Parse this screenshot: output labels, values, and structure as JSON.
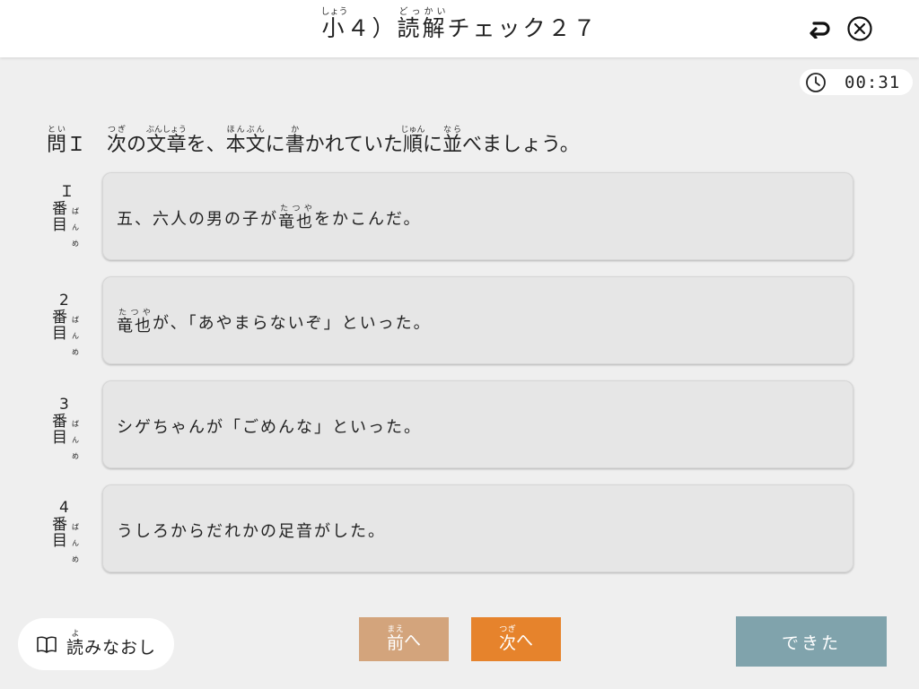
{
  "header": {
    "title_prefix": "小",
    "title_prefix_ruby": "しょう",
    "title_mid": "４）",
    "title_word": "読解",
    "title_word_ruby": "どっかい",
    "title_suffix": "チェック２７"
  },
  "icons": {
    "back": "return-arrow-icon",
    "close": "circle-x-icon",
    "clock": "clock-icon",
    "book": "open-book-icon"
  },
  "timer": {
    "value": "00:31"
  },
  "question": {
    "number": "問",
    "number_ruby": "とい",
    "number_digit": "Ｉ",
    "t1": "次",
    "t1_ruby": "つぎ",
    "t2": "の",
    "t3": "文章",
    "t3_ruby": "ぶんしょう",
    "t4": "を、",
    "t5": "本文",
    "t5_ruby": "ほんぶん",
    "t6": "に",
    "t7": "書",
    "t7_ruby": "か",
    "t8": "かれていた",
    "t9": "順",
    "t9_ruby": "じゅん",
    "t10": "に",
    "t11": "並",
    "t11_ruby": "なら",
    "t12": "べましょう。"
  },
  "row_labels": [
    {
      "num": "Ｉ",
      "k1": "番",
      "k2": "目",
      "furigana": "ばんめ"
    },
    {
      "num": "2",
      "k1": "番",
      "k2": "目",
      "furigana": "ばんめ"
    },
    {
      "num": "3",
      "k1": "番",
      "k2": "目",
      "furigana": "ばんめ"
    },
    {
      "num": "4",
      "k1": "番",
      "k2": "目",
      "furigana": "ばんめ"
    }
  ],
  "cards": [
    {
      "pre": "五、六人の男の子が",
      "word": "竜也",
      "word_ruby": "たつや",
      "post": "をかこんだ。"
    },
    {
      "pre": "",
      "word": "竜也",
      "word_ruby": "たつや",
      "post": "が、「あやまらないぞ」といった。"
    },
    {
      "pre": "シゲちゃんが「ごめんな」といった。",
      "word": "",
      "word_ruby": "",
      "post": ""
    },
    {
      "pre": "うしろからだれかの足音がした。",
      "word": "",
      "word_ruby": "",
      "post": ""
    }
  ],
  "buttons": {
    "reread_kanji": "読",
    "reread_ruby": "よ",
    "reread_rest": "みなおし",
    "prev_kanji": "前",
    "prev_ruby": "まえ",
    "prev_rest": "へ",
    "next_kanji": "次",
    "next_ruby": "つぎ",
    "next_rest": "へ",
    "done": "できた"
  },
  "colors": {
    "prev_button": "#d3a47c",
    "next_button": "#e6832c",
    "done_button": "#80a3ac",
    "background": "#efefef"
  }
}
